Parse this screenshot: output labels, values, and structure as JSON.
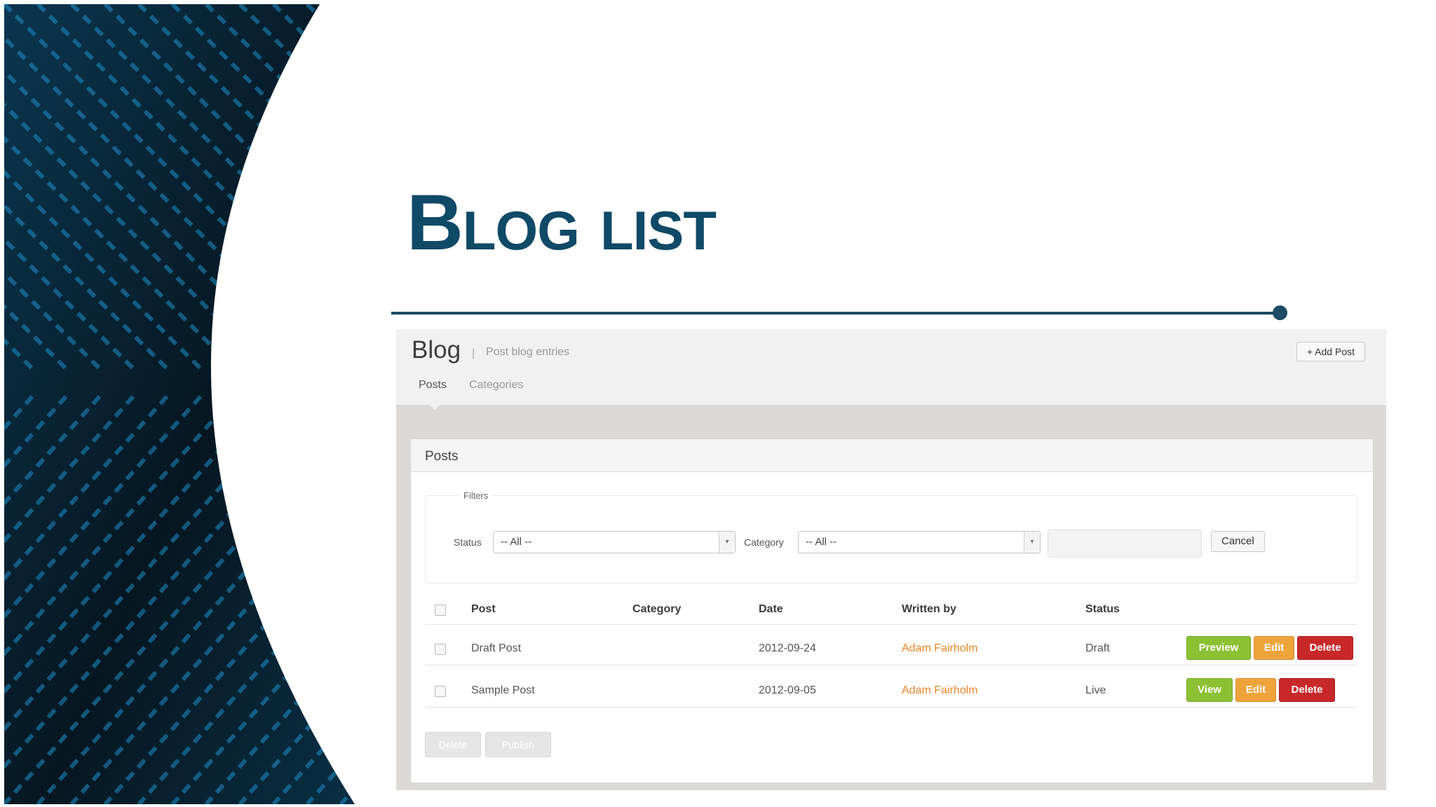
{
  "slide": {
    "title": "Blog list",
    "colors": {
      "title": "#0f4a66",
      "rule": "#1c4b63",
      "panel_dark": "#071a26",
      "panel_stripe": "#1f8ec5"
    }
  },
  "app": {
    "title": "Blog",
    "separator": "|",
    "subtitle": "Post blog entries",
    "add_post_label": "+ Add Post",
    "tabs": [
      {
        "label": "Posts",
        "active": true
      },
      {
        "label": "Categories",
        "active": false
      }
    ],
    "panel_title": "Posts",
    "filters": {
      "legend": "Filters",
      "status_label": "Status",
      "status_value": "-- All --",
      "category_label": "Category",
      "category_value": "-- All --",
      "search_value": "",
      "cancel_label": "Cancel"
    },
    "table": {
      "headers": [
        "Post",
        "Category",
        "Date",
        "Written by",
        "Status"
      ],
      "rows": [
        {
          "post": "Draft Post",
          "category": "",
          "date": "2012-09-24",
          "author": "Adam Fairholm",
          "status": "Draft",
          "actions": [
            "Preview",
            "Edit",
            "Delete"
          ]
        },
        {
          "post": "Sample Post",
          "category": "",
          "date": "2012-09-05",
          "author": "Adam Fairholm",
          "status": "Live",
          "actions": [
            "View",
            "Edit",
            "Delete"
          ]
        }
      ]
    },
    "bulk_actions": [
      "Delete",
      "Publish"
    ],
    "colors": {
      "author": "#e8862a",
      "green": "#8cc134",
      "orange": "#eea33b",
      "red": "#c8282a"
    }
  }
}
